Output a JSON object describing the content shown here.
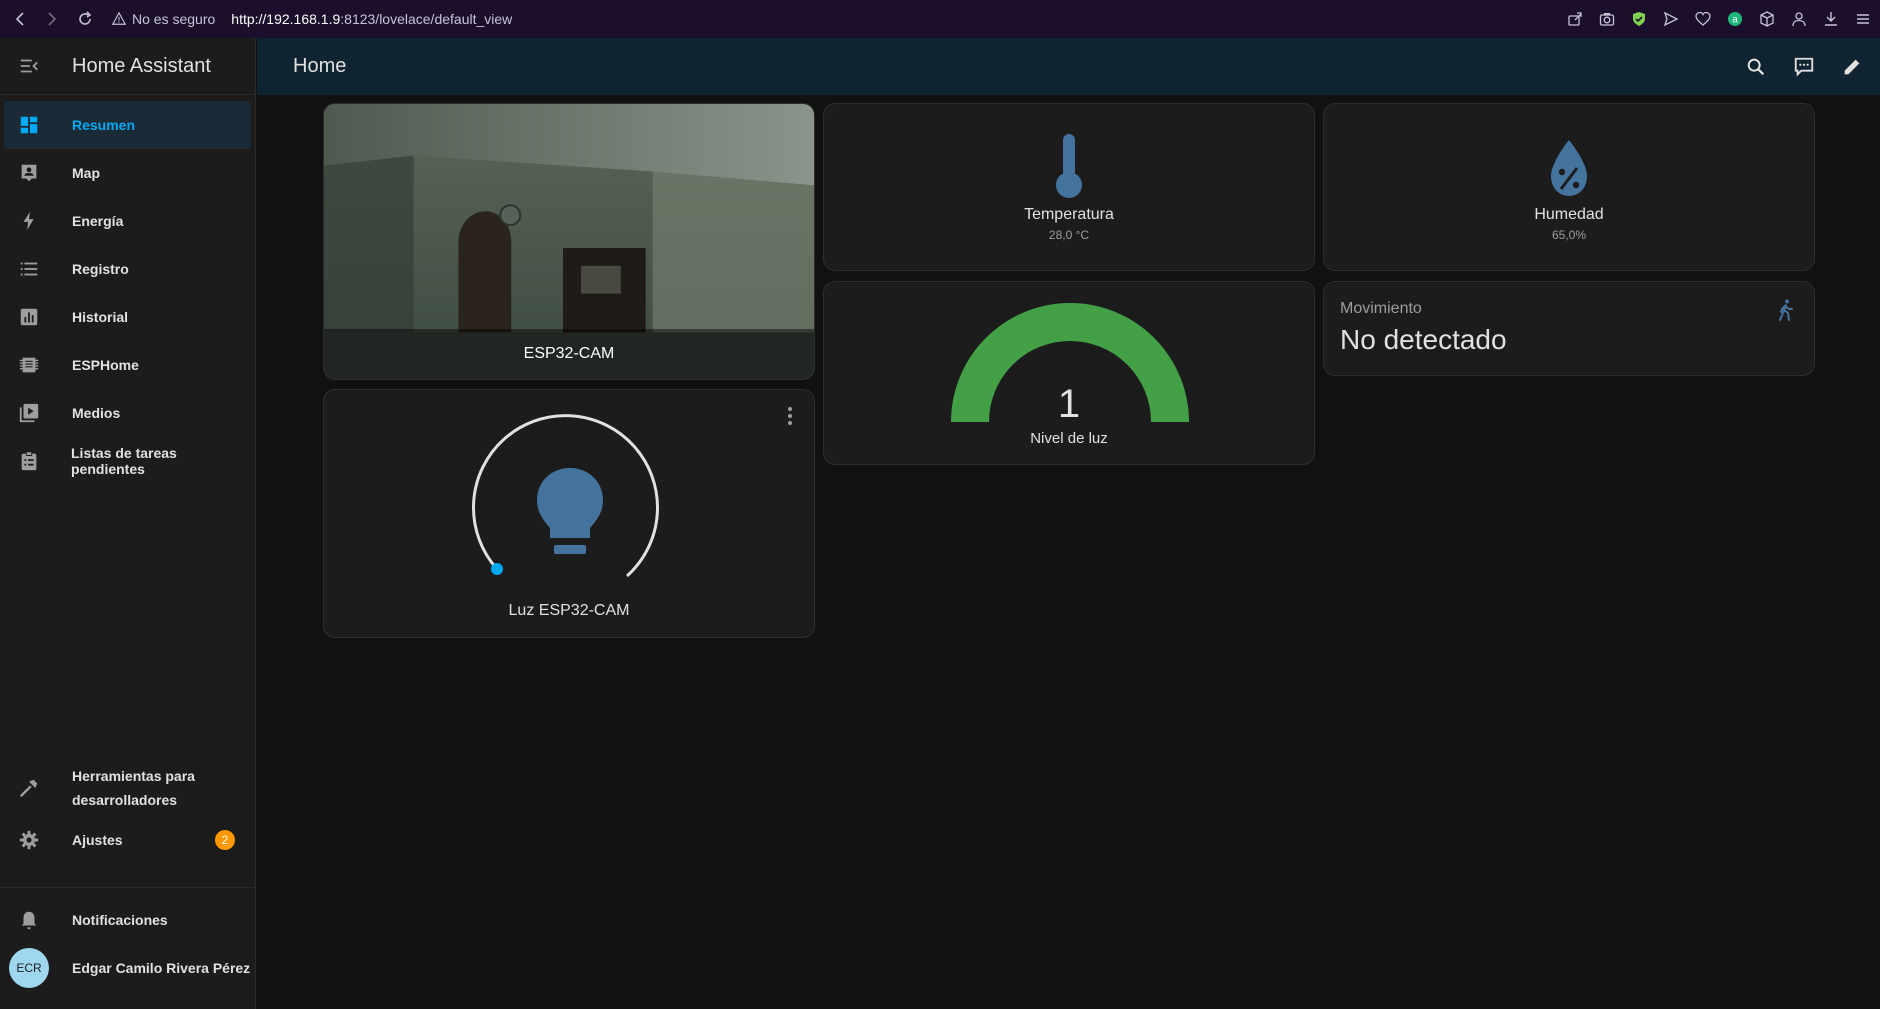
{
  "browser": {
    "security_label": "No es seguro",
    "url_host": "http://192.168.1.9",
    "url_rest": ":8123/lovelace/default_view"
  },
  "sidebar": {
    "title": "Home Assistant",
    "items": [
      {
        "label": "Resumen",
        "icon": "dashboard-icon"
      },
      {
        "label": "Map",
        "icon": "map-account-icon"
      },
      {
        "label": "Energía",
        "icon": "lightning-bolt-icon"
      },
      {
        "label": "Registro",
        "icon": "list-icon"
      },
      {
        "label": "Historial",
        "icon": "chart-box-icon"
      },
      {
        "label": "ESPHome",
        "icon": "chip-icon"
      },
      {
        "label": "Medios",
        "icon": "play-box-icon"
      },
      {
        "label": "Listas de tareas pendientes",
        "icon": "clipboard-list-icon"
      }
    ],
    "dev_tools_line1": "Herramientas para",
    "dev_tools_line2": "desarrolladores",
    "settings_label": "Ajustes",
    "settings_badge": "2",
    "notifications_label": "Notificaciones",
    "user_initials": "ECR",
    "user_name": "Edgar Camilo Rivera Pérez"
  },
  "topbar": {
    "title": "Home"
  },
  "cards": {
    "camera": {
      "name": "ESP32-CAM"
    },
    "temperature": {
      "name": "Temperatura",
      "state": "28,0 °C"
    },
    "humidity": {
      "name": "Humedad",
      "state": "65,0%"
    },
    "light_level": {
      "value": "1",
      "name": "Nivel de luz"
    },
    "motion": {
      "label": "Movimiento",
      "state": "No detectado"
    },
    "light": {
      "name": "Luz ESP32-CAM"
    }
  },
  "colors": {
    "accent": "#03a9f4",
    "state_icon": "#44739e",
    "gauge_green": "#43a047",
    "badge": "#ff9800"
  }
}
